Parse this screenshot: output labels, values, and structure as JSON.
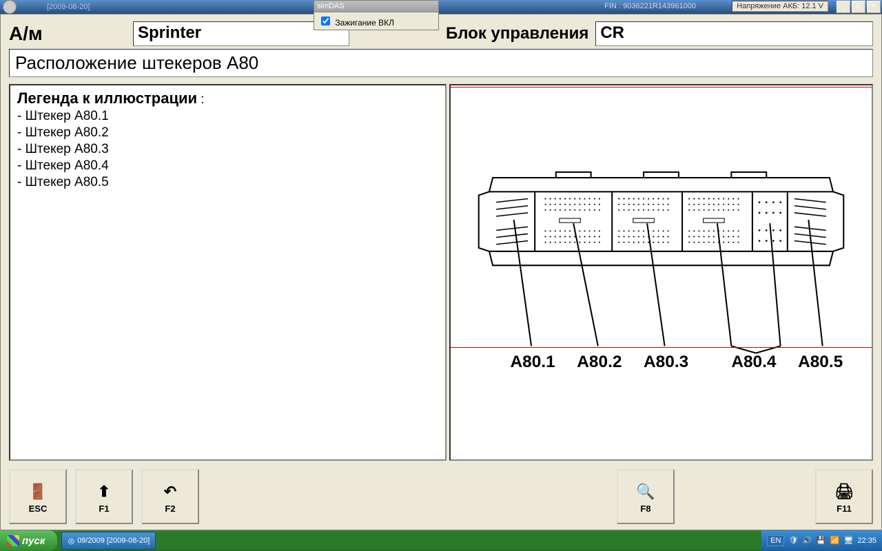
{
  "titlebar": {
    "date": "[2009-08-20]",
    "fin_label": "FIN : 9036221R143961000",
    "voltage_label": "Напряжение АКБ: 12.1 V"
  },
  "simdas": {
    "title": "simDAS",
    "ignition_label": "Зажигание ВКЛ"
  },
  "header": {
    "vehicle_label": "А/м",
    "vehicle_value": "Sprinter",
    "ecu_label": "Блок управления",
    "ecu_value": "CR"
  },
  "section_title": "Расположение штекеров A80",
  "legend": {
    "title": "Легенда к иллюстрации",
    "items": [
      "Штекер A80.1",
      "Штекер A80.2",
      "Штекер A80.3",
      "Штекер A80.4",
      "Штекер A80.5"
    ]
  },
  "diagram": {
    "labels": [
      "A80.1",
      "A80.2",
      "A80.3",
      "A80.4",
      "A80.5"
    ]
  },
  "footer": {
    "esc": "ESC",
    "f1": "F1",
    "f2": "F2",
    "f8": "F8",
    "f11": "F11"
  },
  "taskbar": {
    "start": "пуск",
    "task1": "09/2009 [2009-08-20]",
    "lang": "EN",
    "time": "22:35"
  }
}
